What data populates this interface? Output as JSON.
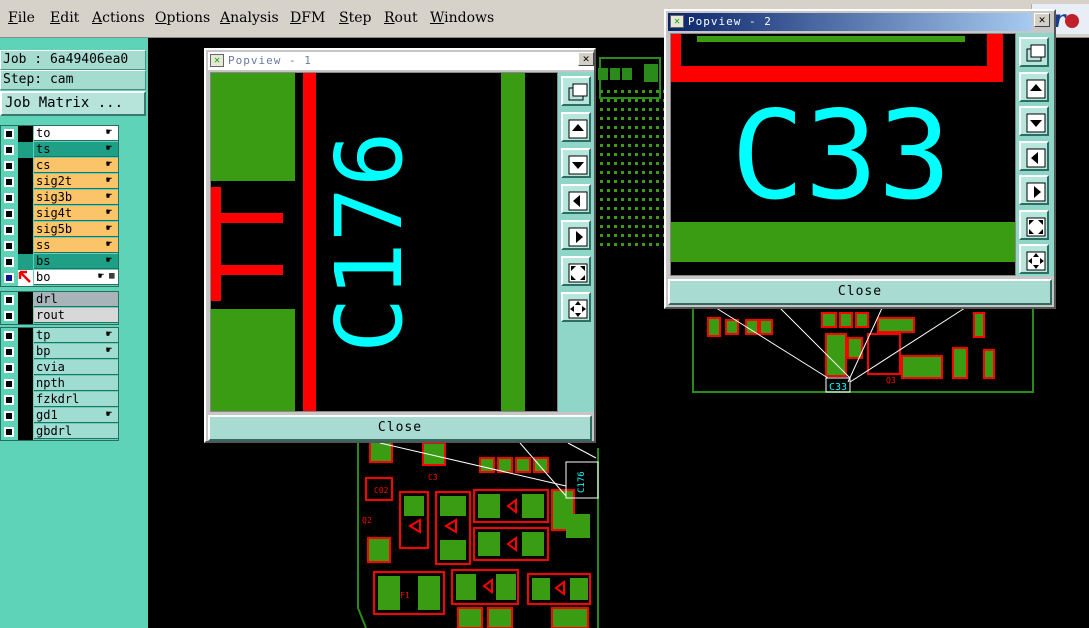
{
  "menubar": {
    "items": [
      "File",
      "Edit",
      "Actions",
      "Options",
      "Analysis",
      "DFM",
      "Step",
      "Rout",
      "Windows"
    ],
    "brand": "Fr"
  },
  "left_panel": {
    "job_label": "Job : 6a49406ea0",
    "step_label": "Step: cam",
    "matrix_button": "Job Matrix ...",
    "layers_board": [
      {
        "name": "to",
        "color": "#ffffff",
        "hand": true
      },
      {
        "name": "ts",
        "color": "#1f9f86",
        "hand": true
      },
      {
        "name": "cs",
        "color": "#fcc468",
        "hand": true
      },
      {
        "name": "sig2t",
        "color": "#fcc468",
        "hand": true
      },
      {
        "name": "sig3b",
        "color": "#fcc468",
        "hand": true
      },
      {
        "name": "sig4t",
        "color": "#fcc468",
        "hand": true
      },
      {
        "name": "sig5b",
        "color": "#fcc468",
        "hand": true
      },
      {
        "name": "ss",
        "color": "#fcc468",
        "hand": true
      },
      {
        "name": "bs",
        "color": "#1f9f86",
        "hand": true
      },
      {
        "name": "bo",
        "color": "#ffffff",
        "hand": true,
        "active": true
      }
    ],
    "layers_drill": [
      {
        "name": "drl",
        "color": "#a8b4ba"
      },
      {
        "name": "rout",
        "color": "#d8d8d8"
      }
    ],
    "layers_misc": [
      {
        "name": "tp",
        "color": "#9fdcd2",
        "hand": true
      },
      {
        "name": "bp",
        "color": "#9fdcd2",
        "hand": true
      },
      {
        "name": "cvia",
        "color": "#9fdcd2"
      },
      {
        "name": "npth",
        "color": "#9fdcd2"
      },
      {
        "name": "fzkdrl",
        "color": "#9fdcd2"
      },
      {
        "name": "gd1",
        "color": "#9fdcd2",
        "hand": true
      },
      {
        "name": "gbdrl",
        "color": "#9fdcd2"
      }
    ]
  },
  "popview1": {
    "title": "Popview - 1",
    "close_label": "Close",
    "designator": "C176"
  },
  "popview2": {
    "title": "Popview - 2",
    "close_label": "Close",
    "designator": "C33"
  },
  "pcb": {
    "label_c33": "C33",
    "label_c176": "C176",
    "silk_c3": "C3",
    "silk_q3": "Q3",
    "silk_f1": "F1",
    "silk_c02": "C02",
    "silk_q2": "Q2"
  },
  "colors": {
    "pad_green": "#3a9c12",
    "trace_red": "#ff0000",
    "silk_cyan": "#00ffff",
    "panel_teal": "#5fd3b8",
    "menu_bg": "#d6d2ca"
  }
}
